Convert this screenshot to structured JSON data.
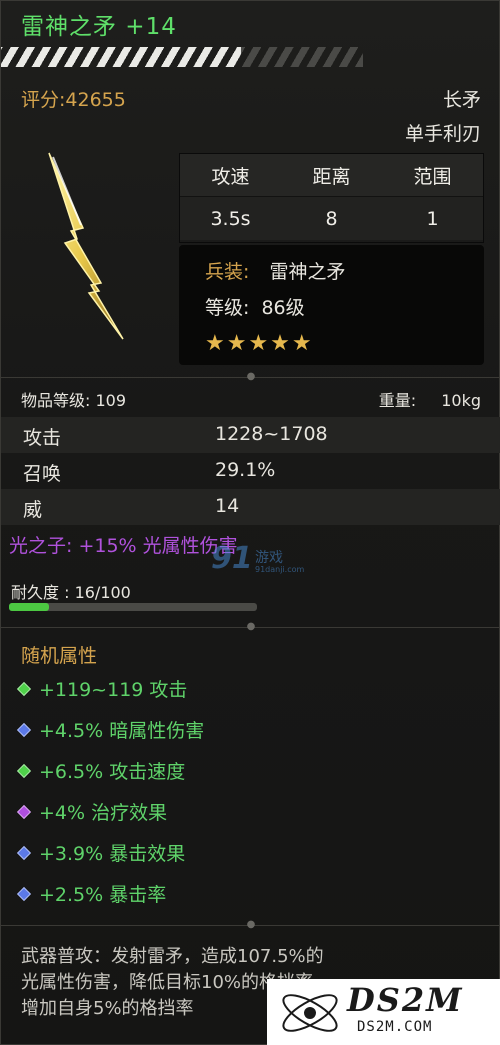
{
  "item": {
    "name": "雷神之矛 +14",
    "score": "评分:42655",
    "weapon_type": "长矛",
    "weapon_subtype": "单手利刃"
  },
  "stats_table": {
    "headers": [
      "攻速",
      "距离",
      "范围"
    ],
    "values": [
      "3.5s",
      "8",
      "1"
    ]
  },
  "equip": {
    "label": "兵装:",
    "name": "雷神之矛",
    "level_label": "等级:",
    "level": "86级",
    "stars": "★★★★★",
    "star_count": 5
  },
  "meta": {
    "item_level": "物品等级: 109",
    "weight_label": "重量:",
    "weight": "10kg"
  },
  "attributes": [
    {
      "key": "攻击",
      "value": "1228~1708"
    },
    {
      "key": "召唤",
      "value": "29.1%"
    },
    {
      "key": "威",
      "value": "14"
    }
  ],
  "special": "光之子: +15% 光属性伤害",
  "durability": {
    "label": "耐久度 : 16/100",
    "fraction": 0.16
  },
  "random": {
    "title": "随机属性",
    "items": [
      {
        "text": "+119~119 攻击",
        "gem_color": "#4fd14a"
      },
      {
        "text": "+4.5% 暗属性伤害",
        "gem_color": "#5b79e8"
      },
      {
        "text": "+6.5% 攻击速度",
        "gem_color": "#4fd14a"
      },
      {
        "text": "+4% 治疗效果",
        "gem_color": "#b04fe0"
      },
      {
        "text": "+3.9% 暴击效果",
        "gem_color": "#5b79e8"
      },
      {
        "text": "+2.5% 暴击率",
        "gem_color": "#5b79e8"
      }
    ]
  },
  "description": {
    "line1": "武器普攻：发射雷矛，造成107.5%的",
    "line2": "光属性伤害，降低目标10%的格挡率，",
    "line3": "增加自身5%的格挡率"
  },
  "watermark": {
    "number": "91",
    "text": "游戏",
    "url": "91danji.com"
  },
  "logo": {
    "main": "DS2M",
    "sub": "DS2M.COM"
  }
}
